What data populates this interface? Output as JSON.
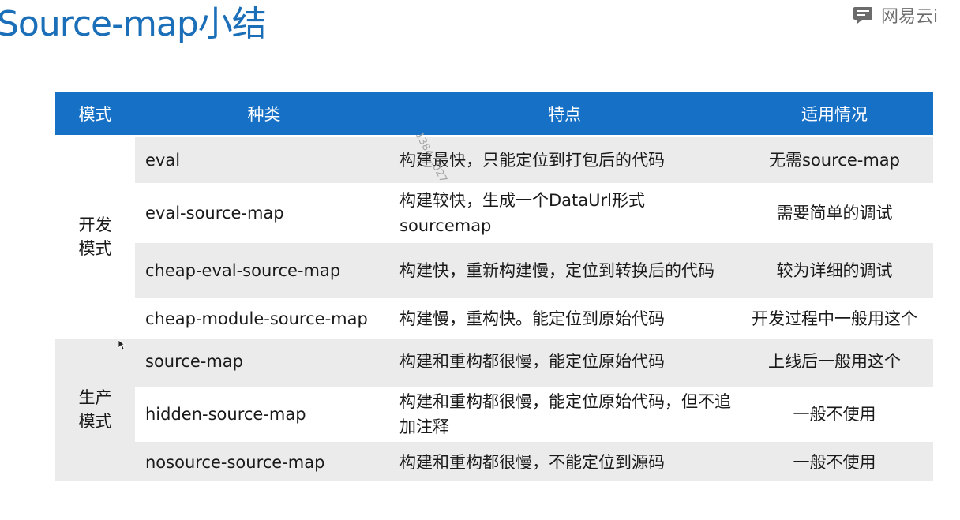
{
  "title": "Source-map小结",
  "brand": {
    "text": "网易云i"
  },
  "watermark": "1384...027",
  "table": {
    "headers": [
      "模式",
      "种类",
      "特点",
      "适用情况"
    ],
    "groups": [
      {
        "label_lines": [
          "开发",
          "模式"
        ],
        "rows": [
          {
            "type": "eval",
            "feature": "构建最快，只能定位到打包后的代码",
            "usage": "无需source-map"
          },
          {
            "type": "eval-source-map",
            "feature": "构建较快，生成一个DataUrl形式sourcemap",
            "usage": "需要简单的调试"
          },
          {
            "type": "cheap-eval-source-map",
            "feature": "构建快，重新构建慢，定位到转换后的代码",
            "usage": "较为详细的调试"
          },
          {
            "type": "cheap-module-source-map",
            "feature": "构建慢，重构快。能定位到原始代码",
            "usage": "开发过程中一般用这个"
          }
        ]
      },
      {
        "label_lines": [
          "生产",
          "模式"
        ],
        "rows": [
          {
            "type": "source-map",
            "feature": "构建和重构都很慢，能定位原始代码",
            "usage": "上线后一般用这个"
          },
          {
            "type": "hidden-source-map",
            "feature": "构建和重构都很慢，能定位原始代码，但不追加注释",
            "usage": "一般不使用"
          },
          {
            "type": "nosource-source-map",
            "feature": "构建和重构都很慢，不能定位到源码",
            "usage": "一般不使用"
          }
        ]
      }
    ]
  },
  "colors": {
    "title": "#1b6fb8",
    "header_bg": "#1670c5",
    "row_shade": "#ebebeb",
    "brand": "#6b6b6b"
  }
}
